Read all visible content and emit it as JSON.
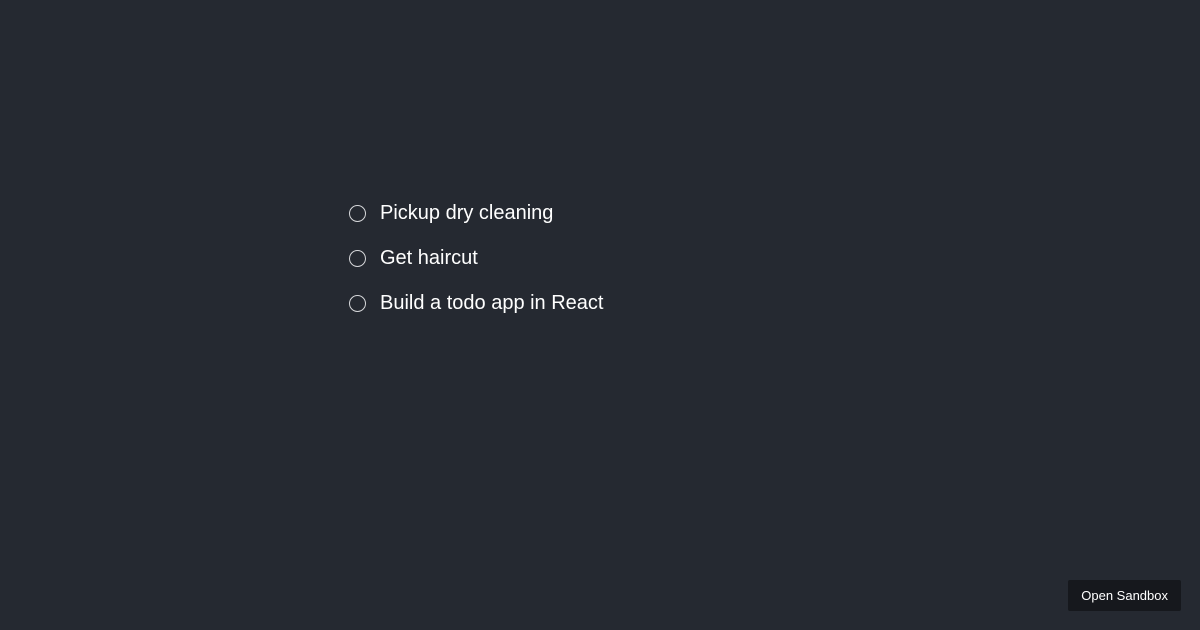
{
  "todos": {
    "items": [
      {
        "label": "Pickup dry cleaning",
        "completed": false
      },
      {
        "label": "Get haircut",
        "completed": false
      },
      {
        "label": "Build a todo app in React",
        "completed": false
      }
    ]
  },
  "footer": {
    "open_sandbox_label": "Open Sandbox"
  }
}
